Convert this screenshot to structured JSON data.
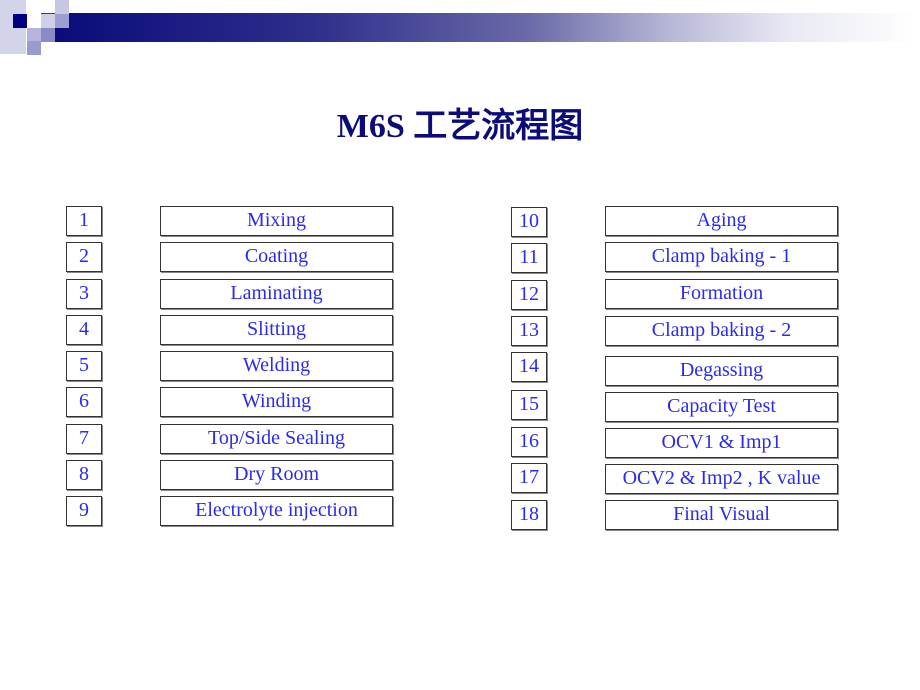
{
  "slide": {
    "title": "M6S 工艺流程图",
    "left_column": [
      {
        "number": "1",
        "step": "Mixing"
      },
      {
        "number": "2",
        "step": "Coating"
      },
      {
        "number": "3",
        "step": "Laminating"
      },
      {
        "number": "4",
        "step": "Slitting"
      },
      {
        "number": "5",
        "step": "Welding"
      },
      {
        "number": "6",
        "step": "Winding"
      },
      {
        "number": "7",
        "step": "Top/Side Sealing"
      },
      {
        "number": "8",
        "step": "Dry Room"
      },
      {
        "number": "9",
        "step": "Electrolyte injection"
      }
    ],
    "right_column": [
      {
        "number": "10",
        "step": "Aging"
      },
      {
        "number": "11",
        "step": "Clamp baking - 1"
      },
      {
        "number": "12",
        "step": "Formation"
      },
      {
        "number": "13",
        "step": "Clamp baking - 2"
      },
      {
        "number": "14",
        "step": "Degassing"
      },
      {
        "number": "15",
        "step": "Capacity Test"
      },
      {
        "number": "16",
        "step": "OCV1 & Imp1"
      },
      {
        "number": "17",
        "step": "OCV2 & Imp2 , K value"
      },
      {
        "number": "18",
        "step": "Final Visual"
      }
    ]
  },
  "colors": {
    "title": "#0b0b7a",
    "step_text": "#2a2af0",
    "banner": "#0b0b7a"
  }
}
